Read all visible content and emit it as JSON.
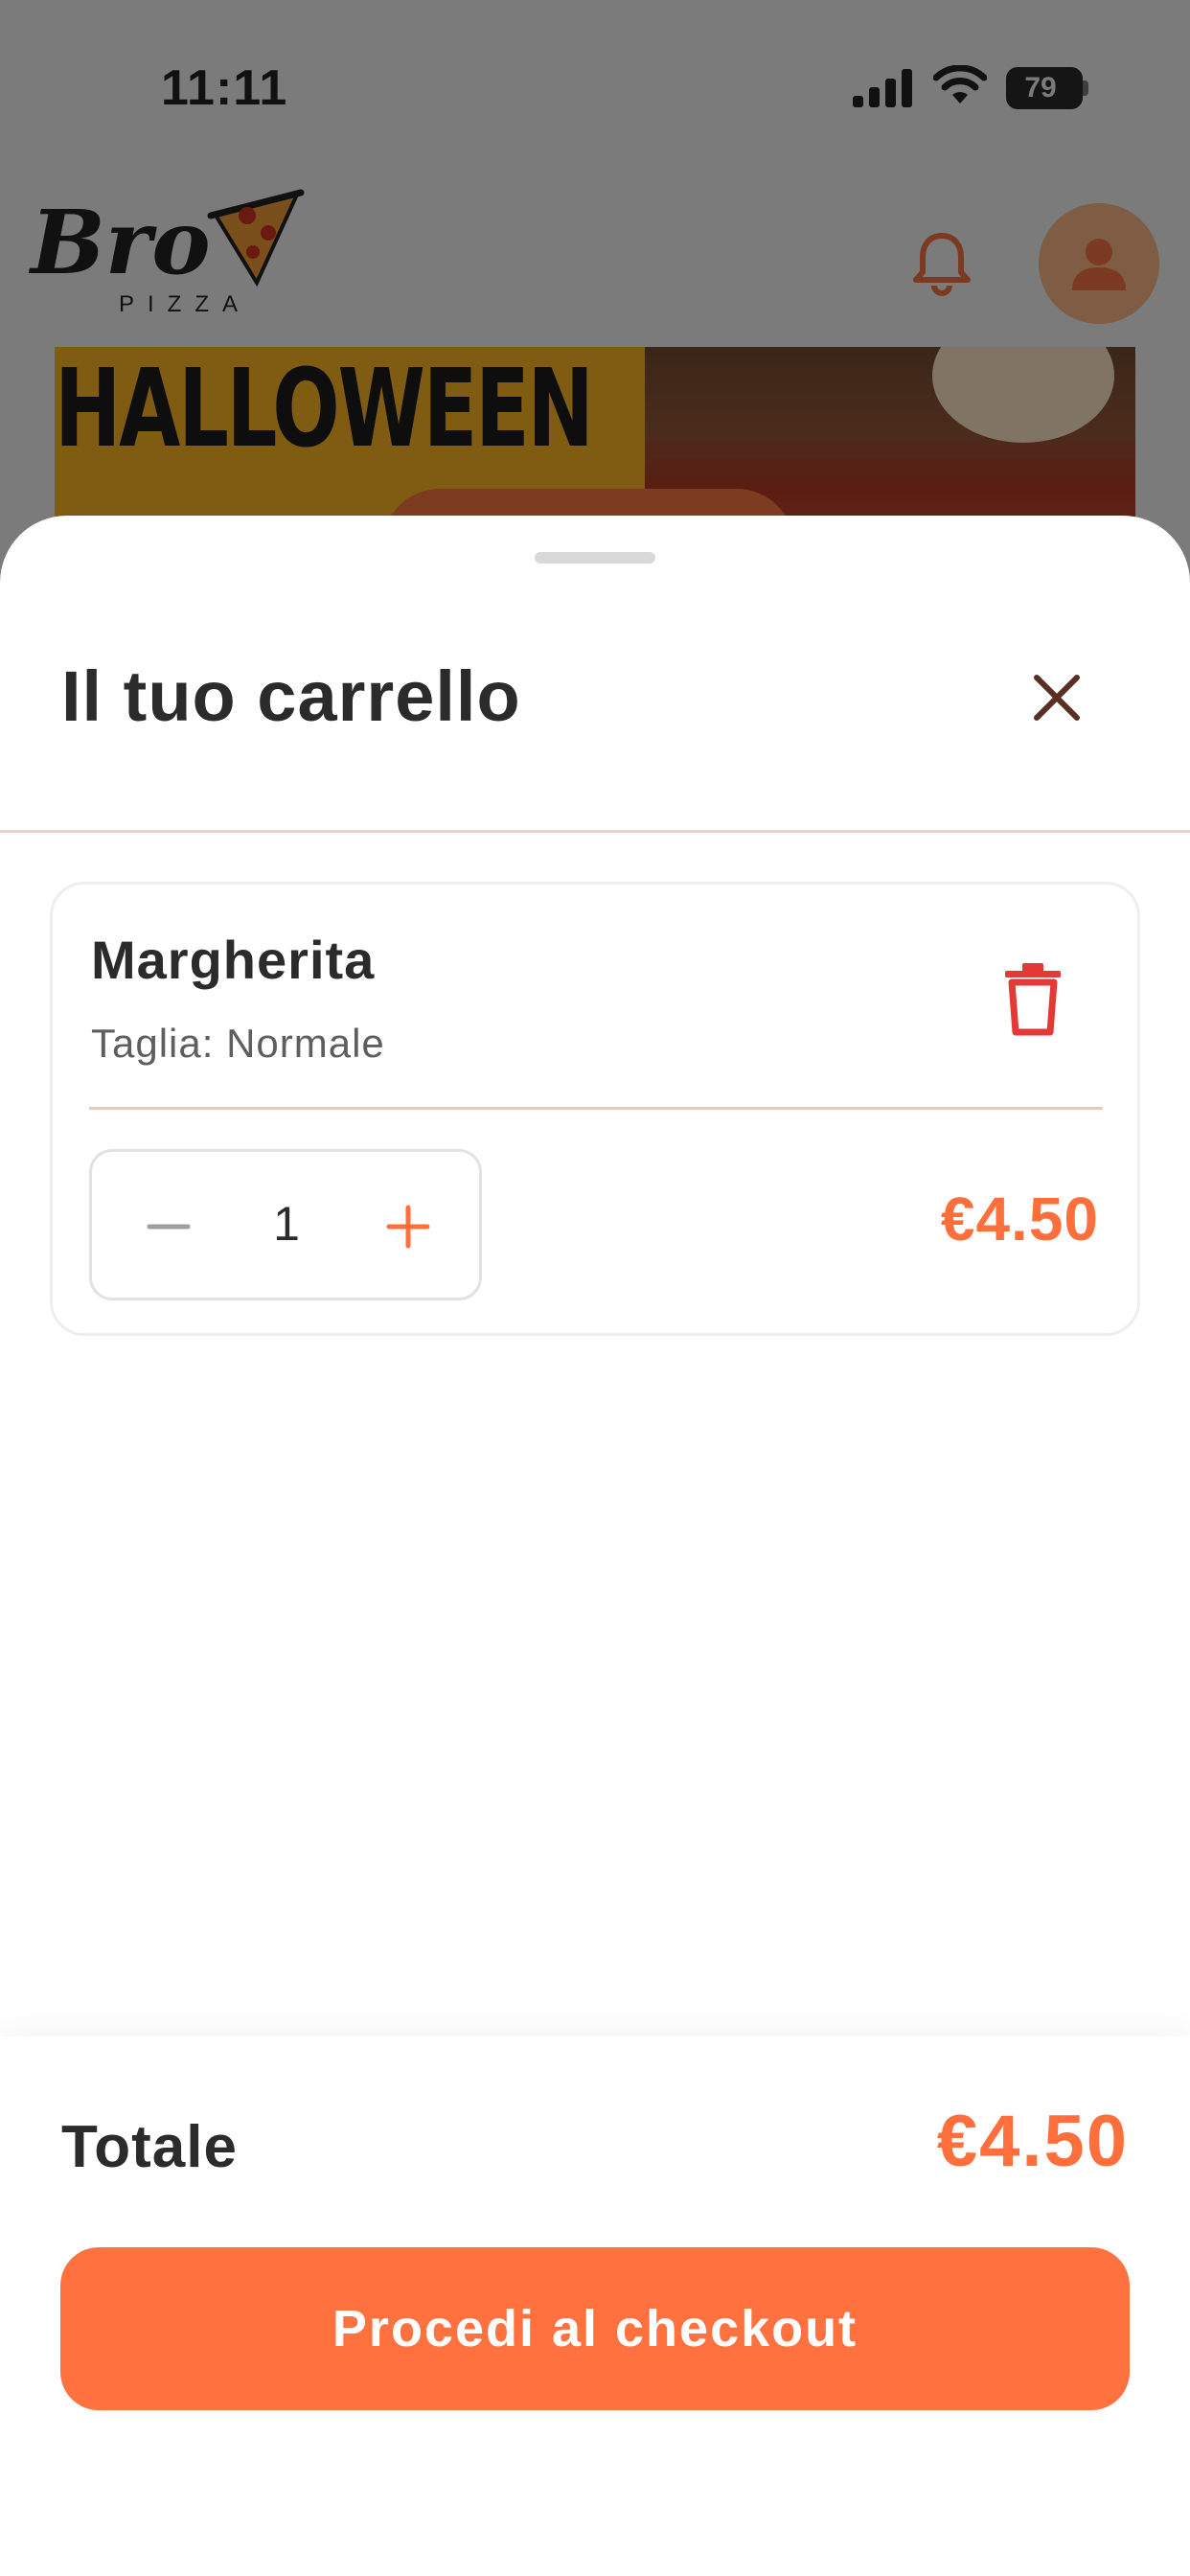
{
  "status_bar": {
    "time": "11:11",
    "battery": "79"
  },
  "header": {
    "logo_text": "Bro",
    "logo_sub": "PIZZA"
  },
  "banner": {
    "title": "HALLOWEEN"
  },
  "cart": {
    "title": "Il tuo carrello",
    "items": [
      {
        "name": "Margherita",
        "size": "Taglia: Normale",
        "quantity": "1",
        "price": "€4.50"
      }
    ],
    "total_label": "Totale",
    "total_value": "€4.50",
    "checkout_label": "Procedi al checkout"
  },
  "colors": {
    "accent": "#ff6f3c",
    "button": "#ff7240",
    "delete": "#e53935",
    "text": "#2b2b2b"
  },
  "icons": [
    "signal-icon",
    "wifi-icon",
    "battery-icon",
    "bell-icon",
    "user-icon",
    "close-icon",
    "trash-icon",
    "minus-icon",
    "plus-icon"
  ]
}
